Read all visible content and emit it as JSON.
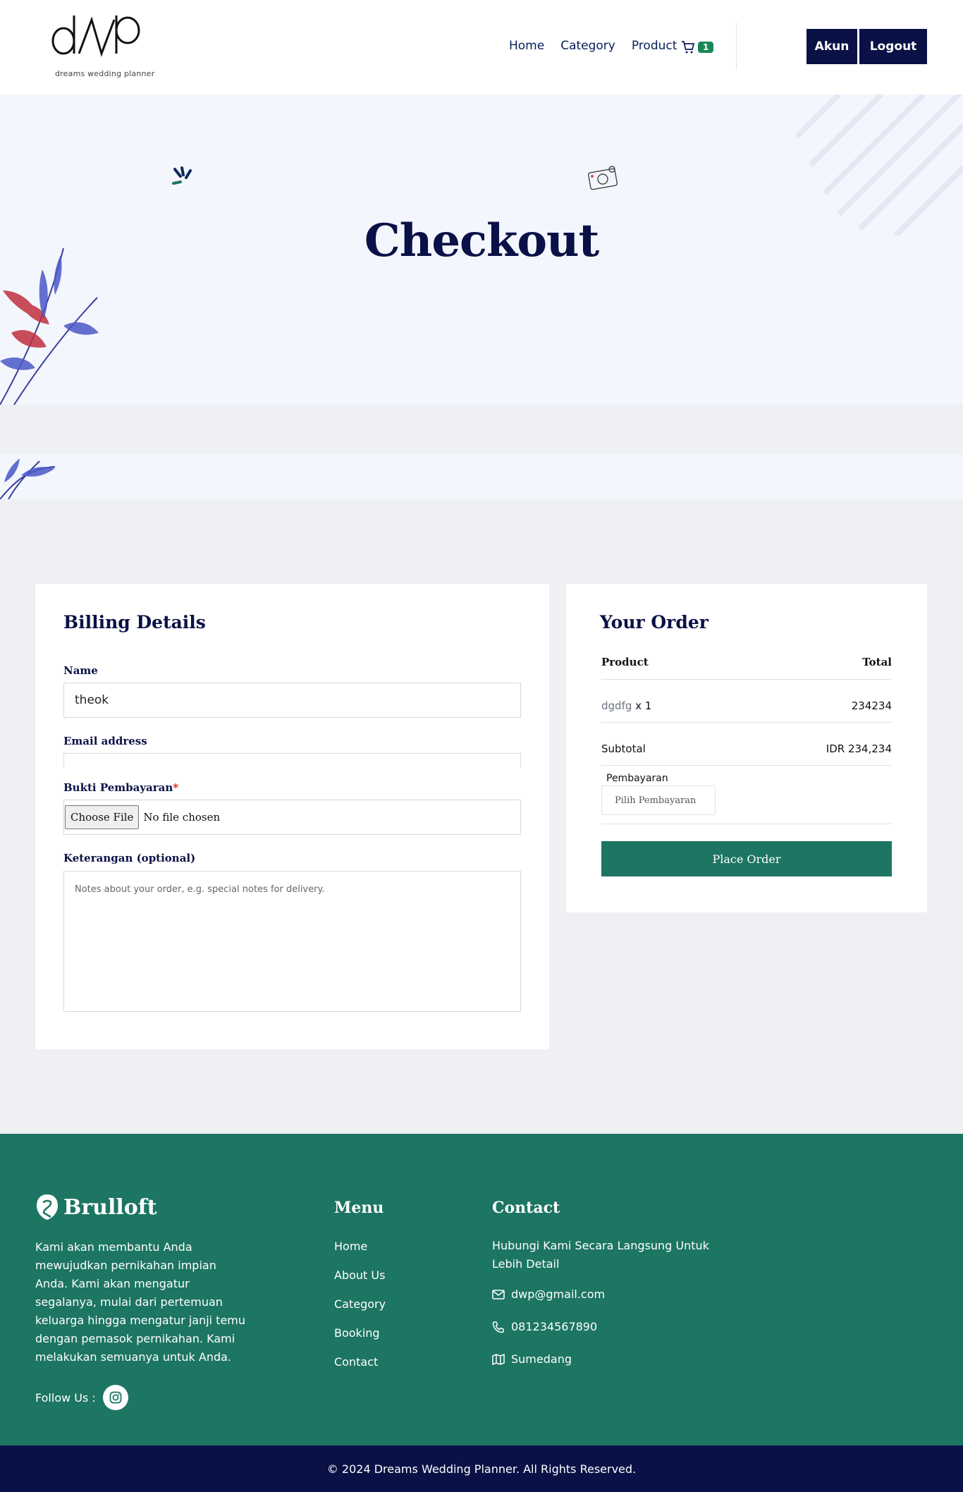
{
  "brand": {
    "logo_sub": "dreams wedding planner"
  },
  "nav": {
    "links": [
      "Home",
      "Category",
      "Product"
    ],
    "cart_count": "1",
    "akun_label": "Akun",
    "logout_label": "Logout"
  },
  "hero": {
    "title": "Checkout"
  },
  "billing": {
    "title": "Billing Details",
    "name_label": "Name",
    "name_value": "theok",
    "email_label": "Email address",
    "proof_label": "Bukti Pembayaran",
    "proof_required_mark": "*",
    "file_button": "Choose File",
    "file_status": "No file chosen",
    "notes_label": "Keterangan (optional)",
    "notes_placeholder": "Notes about your order, e.g. special notes for delivery."
  },
  "order": {
    "title": "Your Order",
    "col_product": "Product",
    "col_total": "Total",
    "item_name": "dgdfg",
    "item_qty": "x 1",
    "item_total": "234234",
    "subtotal_label": "Subtotal",
    "subtotal_value": "IDR 234,234",
    "payment_label": "Pembayaran",
    "payment_placeholder": "Pilih Pembayaran",
    "place_order": "Place Order"
  },
  "footer": {
    "brand_name": "Brulloft",
    "about": "Kami akan membantu Anda mewujudkan pernikahan impian Anda. Kami akan mengatur segalanya, mulai dari pertemuan keluarga hingga mengatur janji temu dengan pemasok pernikahan. Kami melakukan semuanya untuk Anda.",
    "follow_label": "Follow Us :",
    "menu_heading": "Menu",
    "menu_items": [
      "Home",
      "About Us",
      "Category",
      "Booking",
      "Contact"
    ],
    "contact_heading": "Contact",
    "contact_text": "Hubungi Kami Secara Langsung Untuk Lebih Detail",
    "email": "dwp@gmail.com",
    "phone": "081234567890",
    "location": "Sumedang",
    "copyright": "© 2024 Dreams Wedding Planner. All Rights Reserved."
  },
  "colors": {
    "navy": "#0a1146",
    "green": "#1d7563",
    "badge_green": "#198754",
    "hero_bg": "#f3f6fd",
    "page_bg": "#eef0f4"
  },
  "icons": [
    "cart-icon",
    "leaf-decoration",
    "camera-decoration",
    "sparkle-decoration",
    "email-icon",
    "phone-icon",
    "map-icon",
    "instagram-icon"
  ]
}
